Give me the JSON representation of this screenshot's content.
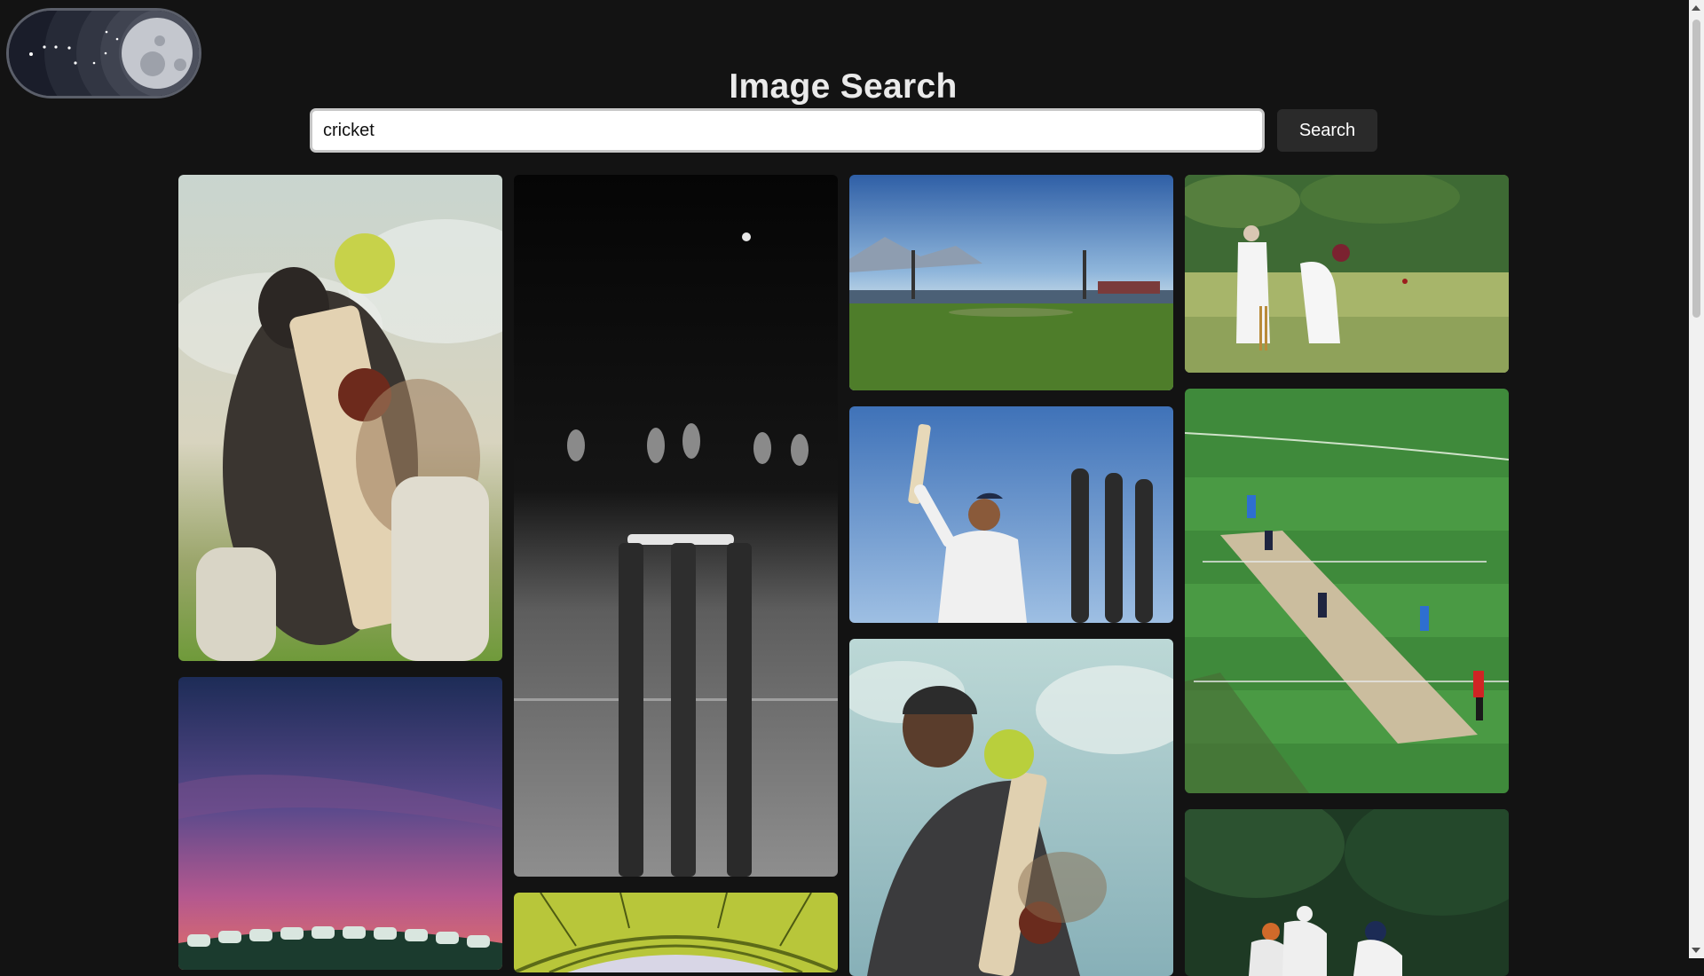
{
  "page": {
    "title": "Image Search"
  },
  "theme_toggle": {
    "state": "dark",
    "icon": "moon-icon"
  },
  "search": {
    "value": "cricket",
    "placeholder": "",
    "button_label": "Search"
  },
  "results": [
    {
      "name": "result-batsman-ball-impact",
      "subject": "batsman hitting ball"
    },
    {
      "name": "result-wicket-stumps-night",
      "subject": "wicket stumps"
    },
    {
      "name": "result-stadium-mountains",
      "subject": "cricket stadium"
    },
    {
      "name": "result-batsman-bowled",
      "subject": "batsman and wicket keeper"
    },
    {
      "name": "result-batsman-celebrating",
      "subject": "batsman raising bat"
    },
    {
      "name": "result-aerial-match",
      "subject": "match on pitch"
    },
    {
      "name": "result-stadium-sunset",
      "subject": "stadium at dusk"
    },
    {
      "name": "result-batsman-sky",
      "subject": "batsman with sky"
    },
    {
      "name": "result-stadium-roof",
      "subject": "stadium roof"
    },
    {
      "name": "result-players-fielding",
      "subject": "players fielding"
    }
  ],
  "colors": {
    "background": "#131313",
    "title": "#eaeaea",
    "button_bg": "#2a2a2a"
  }
}
